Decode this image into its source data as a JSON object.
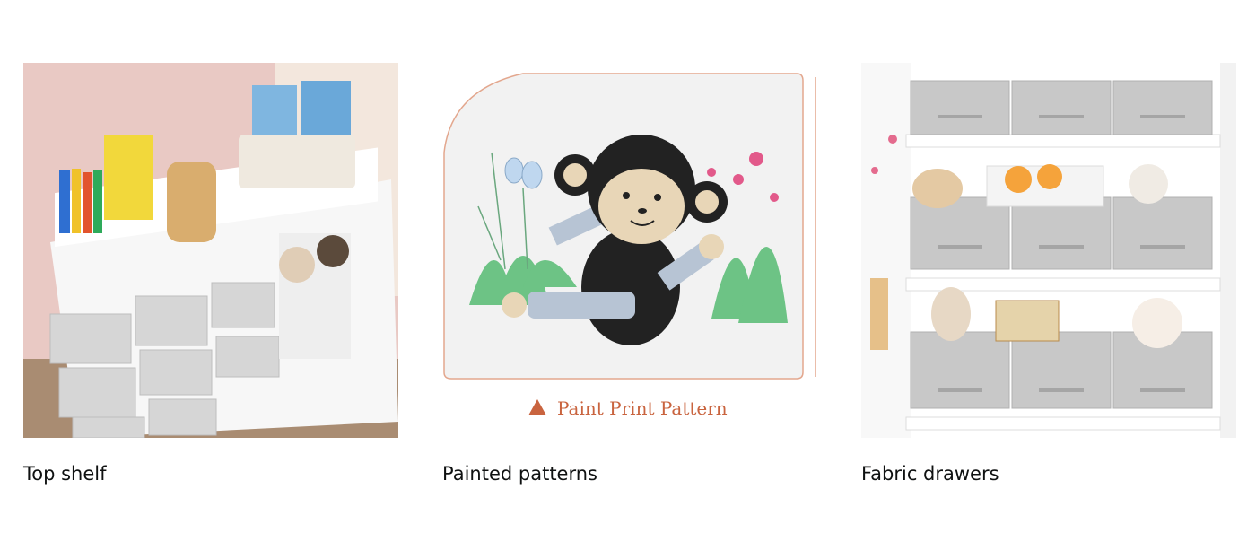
{
  "cards": [
    {
      "caption": "Top shelf",
      "image": "toy-storage-top-shelf-photo"
    },
    {
      "caption": "Painted patterns",
      "image": "monkey-painted-pattern-illustration",
      "overlay_text": "Paint Print Pattern"
    },
    {
      "caption": "Fabric drawers",
      "image": "grey-fabric-drawers-photo"
    }
  ],
  "colors": {
    "caption_text": "#0f1111",
    "accent": "#c9643f",
    "drawer_grey": "#c8c8c8"
  }
}
